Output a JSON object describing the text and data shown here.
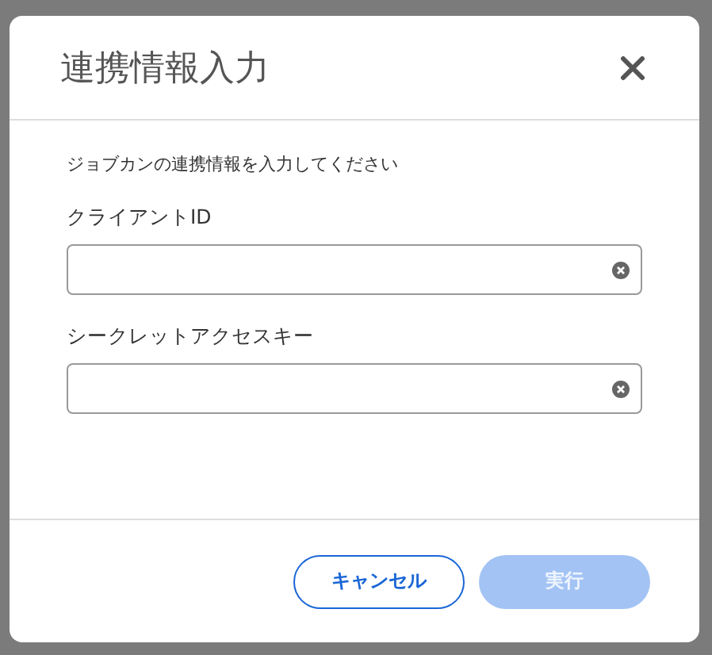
{
  "dialog": {
    "title": "連携情報入力",
    "description": "ジョブカンの連携情報を入力してください",
    "fields": [
      {
        "label": "クライアントID"
      },
      {
        "label": "シークレットアクセスキー"
      }
    ],
    "buttons": [
      {
        "label": "キャンセル",
        "kind": "secondary",
        "disabled": false
      },
      {
        "label": "実行",
        "kind": "primary",
        "disabled": true
      }
    ]
  }
}
